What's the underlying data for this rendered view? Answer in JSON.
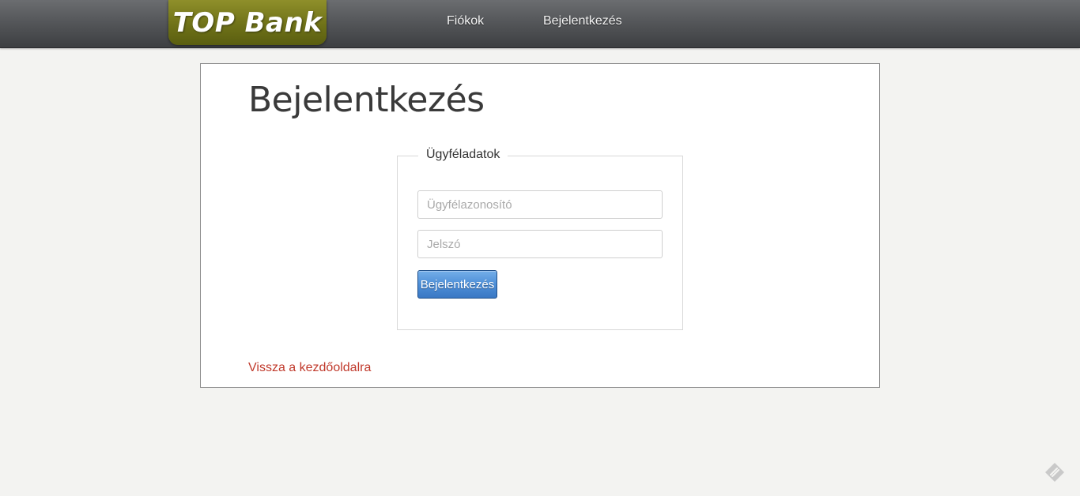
{
  "header": {
    "logo_text": "TOP Bank",
    "nav": [
      {
        "label": "Fiókok"
      },
      {
        "label": "Bejelentkezés"
      }
    ]
  },
  "main": {
    "title": "Bejelentkezés",
    "form": {
      "legend": "Ügyféladatok",
      "customer_id_placeholder": "Ügyfélazonosító",
      "customer_id_value": "",
      "password_placeholder": "Jelszó",
      "password_value": "",
      "submit_label": "Bejelentkezés"
    },
    "back_link": "Vissza a kezdőoldalra"
  },
  "icons": {
    "corner": "feedback-icon"
  },
  "colors": {
    "topbar": "#55575a",
    "logo": "#6f7218",
    "button": "#4e8fd8",
    "link": "#c0392b",
    "background": "#f3f3f1"
  }
}
